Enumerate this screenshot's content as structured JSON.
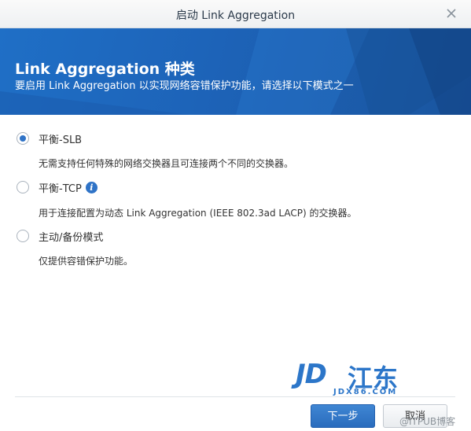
{
  "window": {
    "title": "启动 Link Aggregation",
    "close_icon": "close-icon"
  },
  "banner": {
    "heading": "Link Aggregation 种类",
    "subtitle": "要启用 Link Aggregation 以实现网络容错保护功能，请选择以下模式之一"
  },
  "options": [
    {
      "label": "平衡-SLB",
      "checked": true,
      "description": "无需支持任何特殊的网络交换器且可连接两个不同的交换器。"
    },
    {
      "label": "平衡-TCP",
      "checked": false,
      "info_icon": "i",
      "description": "用于连接配置为动态 Link Aggregation (IEEE 802.3ad LACP) 的交换器。"
    },
    {
      "label": "主动/备份模式",
      "checked": false,
      "description": "仅提供容错保护功能。"
    }
  ],
  "buttons": {
    "next": "下一步",
    "cancel": "取消"
  },
  "watermark": {
    "logo_latin": "JD",
    "logo_cn": "江东",
    "url": "JDX86.COM",
    "csdn": "@ITPUB博客"
  },
  "colors": {
    "accent": "#2f73c7",
    "banner": "#1d63b8"
  }
}
